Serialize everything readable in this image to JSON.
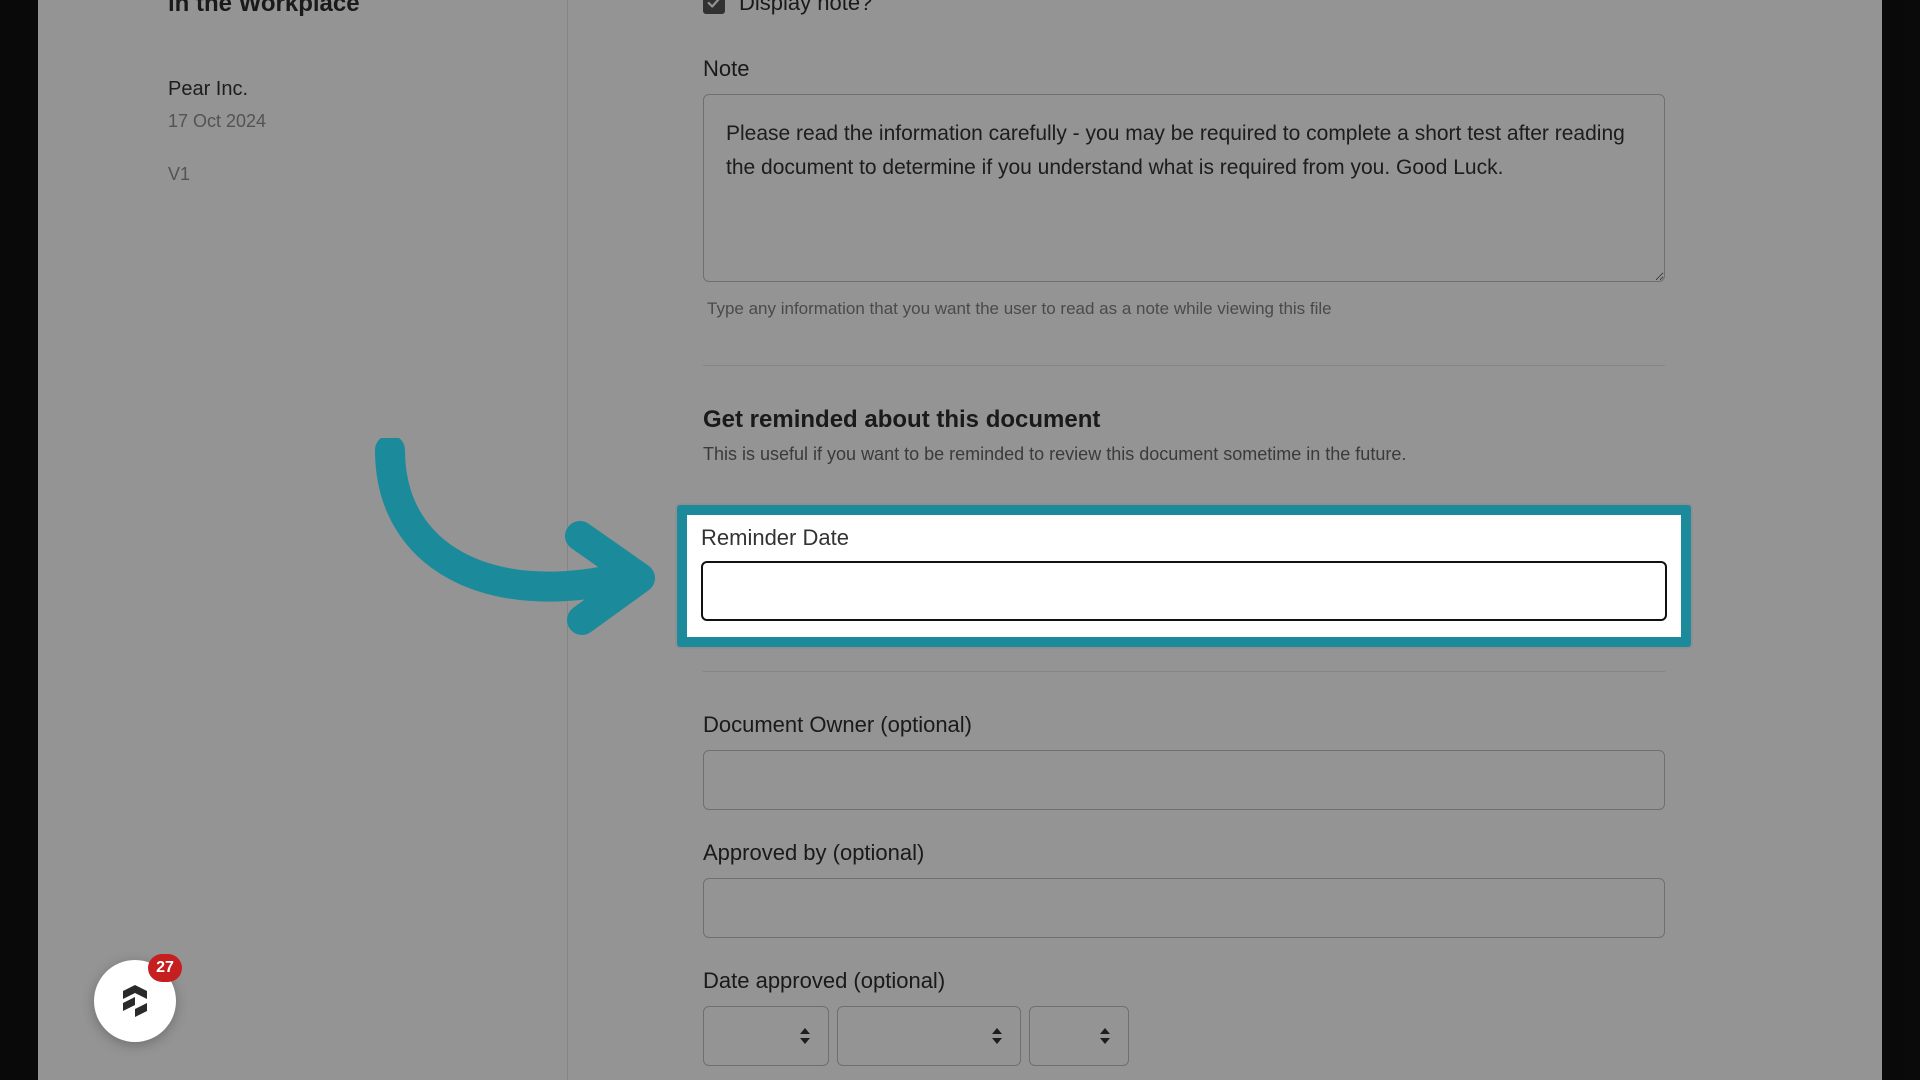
{
  "sidebar": {
    "title": "in the Workplace",
    "company": "Pear Inc.",
    "date": "17 Oct 2024",
    "version": "V1"
  },
  "checkbox": {
    "label": "Display note?"
  },
  "note": {
    "label": "Note",
    "value": "Please read the information carefully - you may be required to complete a short test after reading the document to determine if you understand what is required from you. Good Luck.",
    "helper": "Type any information that you want the user to read as a note while viewing this file"
  },
  "reminder": {
    "heading": "Get reminded about this document",
    "subtext": "This is useful if you want to be reminded to review this document sometime in the future.",
    "label": "Reminder Date",
    "value": ""
  },
  "owner": {
    "label": "Document Owner (optional)",
    "value": ""
  },
  "approved_by": {
    "label": "Approved by (optional)",
    "value": ""
  },
  "date_approved": {
    "label": "Date approved (optional)"
  },
  "chat": {
    "badge": "27"
  },
  "highlight_color": "#1b8a9a"
}
